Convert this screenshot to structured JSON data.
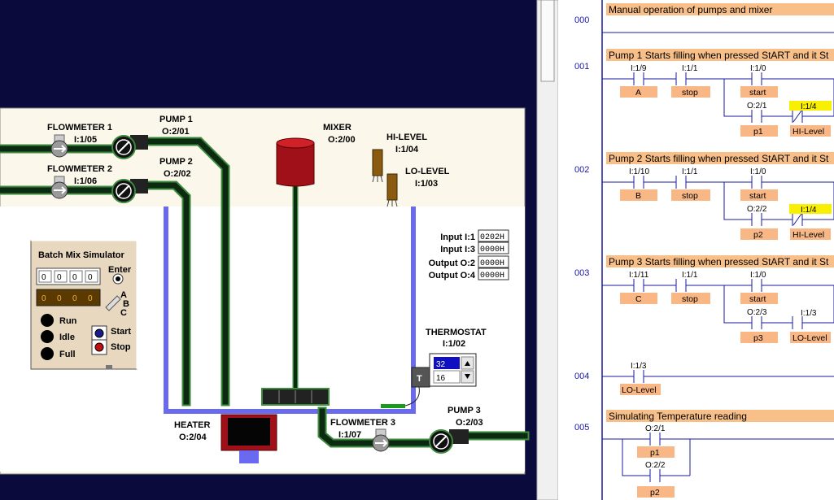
{
  "simulator": {
    "flowmeter1": {
      "name": "FLOWMETER 1",
      "addr": "I:1/05"
    },
    "flowmeter2": {
      "name": "FLOWMETER 2",
      "addr": "I:1/06"
    },
    "flowmeter3": {
      "name": "FLOWMETER 3",
      "addr": "I:1/07"
    },
    "pump1": {
      "name": "PUMP 1",
      "addr": "O:2/01"
    },
    "pump2": {
      "name": "PUMP 2",
      "addr": "O:2/02"
    },
    "pump3": {
      "name": "PUMP 3",
      "addr": "O:2/03"
    },
    "mixer": {
      "name": "MIXER",
      "addr": "O:2/00"
    },
    "hi_level": {
      "name": "HI-LEVEL",
      "addr": "I:1/04"
    },
    "lo_level": {
      "name": "LO-LEVEL",
      "addr": "I:1/03"
    },
    "heater": {
      "name": "HEATER",
      "addr": "O:2/04"
    },
    "thermostat": {
      "name": "THERMOSTAT",
      "addr": "I:1/02",
      "setpoint": "32",
      "value": "16",
      "button": "T"
    },
    "io_table": [
      {
        "label": "Input I:1",
        "value": "0202H"
      },
      {
        "label": "Input I:3",
        "value": "0000H"
      },
      {
        "label": "Output O:2",
        "value": "0000H"
      },
      {
        "label": "Output O:4",
        "value": "0000H"
      }
    ],
    "panel": {
      "title": "Batch Mix Simulator",
      "thumbwheel": [
        "0",
        "0",
        "0",
        "0"
      ],
      "display": [
        "0",
        "0",
        "0",
        "0"
      ],
      "enter": "Enter",
      "abc": [
        "A",
        "B",
        "C"
      ],
      "lamps": [
        "Run",
        "Idle",
        "Full"
      ],
      "buttons": [
        "Start",
        "Stop"
      ]
    }
  },
  "ladder": {
    "rungs": [
      {
        "num": "000",
        "comment": "Manual operation of pumps and mixer"
      },
      {
        "num": "001",
        "comment": "Pump 1 Starts filling when pressed StART and it St",
        "c1_addr": "I:1/9",
        "c1_tag": "A",
        "c2_addr": "I:1/1",
        "c2_tag": "stop",
        "c3_addr": "I:1/0",
        "c3_tag": "start",
        "c4_addr": "O:2/1",
        "c4_tag": "p1",
        "c5_addr": "I:1/4",
        "c5_tag": "HI-Level"
      },
      {
        "num": "002",
        "comment": "Pump 2 Starts filling when pressed StART and it St",
        "c1_addr": "I:1/10",
        "c1_tag": "B",
        "c2_addr": "I:1/1",
        "c2_tag": "stop",
        "c3_addr": "I:1/0",
        "c3_tag": "start",
        "c4_addr": "O:2/2",
        "c4_tag": "p2",
        "c5_addr": "I:1/4",
        "c5_tag": "HI-Level"
      },
      {
        "num": "003",
        "comment": "Pump 3 Starts filling when pressed StART and it St",
        "c1_addr": "I:1/11",
        "c1_tag": "C",
        "c2_addr": "I:1/1",
        "c2_tag": "stop",
        "c3_addr": "I:1/0",
        "c3_tag": "start",
        "c4_addr": "O:2/3",
        "c4_tag": "p3",
        "c5_addr": "I:1/3",
        "c5_tag": "LO-Level"
      },
      {
        "num": "004",
        "c1_addr": "I:1/3",
        "c1_tag": "LO-Level"
      },
      {
        "num": "005",
        "comment": "Simulating Temperature reading",
        "c1_addr": "O:2/1",
        "c1_tag": "p1",
        "c2_addr": "O:2/2",
        "c2_tag": "p2"
      }
    ]
  },
  "colors": {
    "background": "#0a0a3c",
    "panel": "#fbf7ea",
    "pipe": "#0c2a12",
    "pipe_edge": "#3c8a3c",
    "tank": "#6a6af0",
    "tag": "#f8b784",
    "hilite": "#f8f000",
    "comment": "#f8c088",
    "ladder_bg": "#ffffff"
  }
}
